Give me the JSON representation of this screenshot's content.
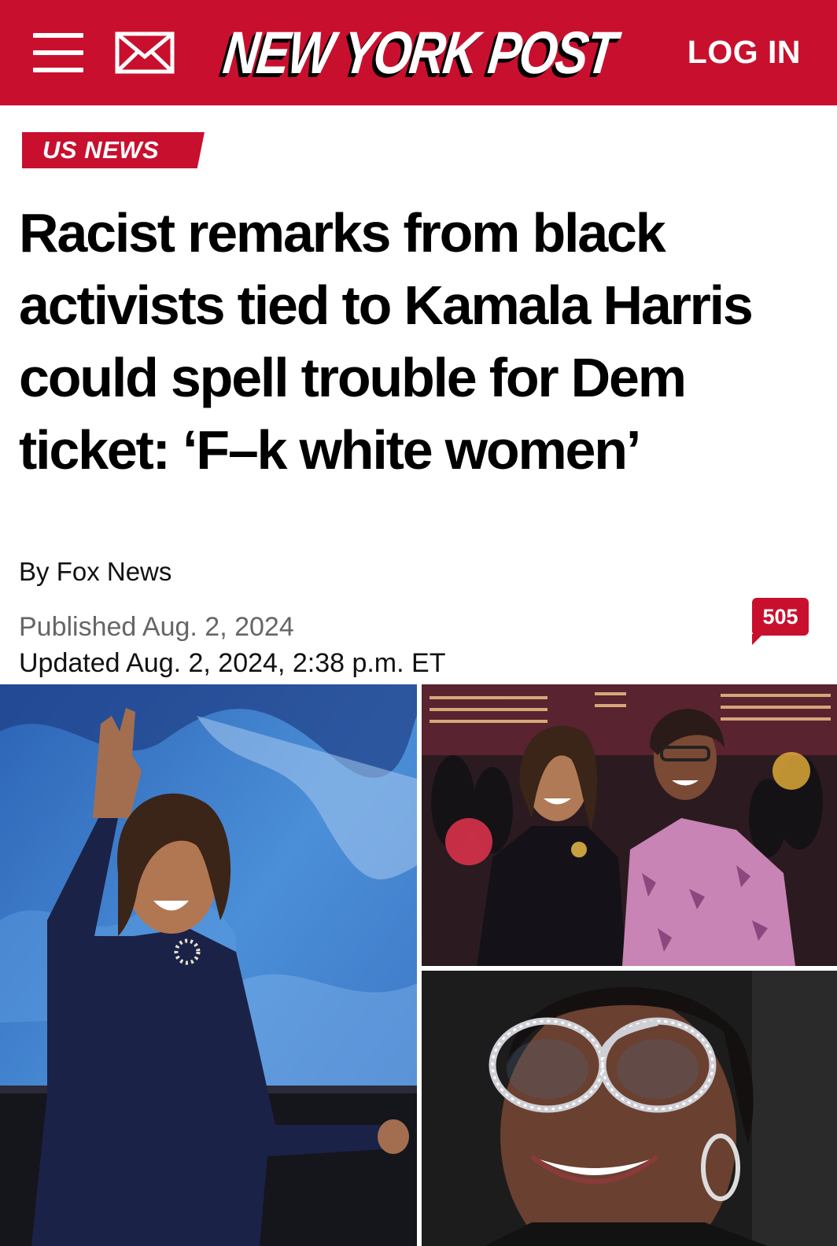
{
  "header": {
    "logo_text": "NEW YORK POST",
    "login_label": "LOG IN",
    "menu_icon": "hamburger-menu-icon",
    "mail_icon": "envelope-icon",
    "brand_color": "#c8102e"
  },
  "article": {
    "category": "US NEWS",
    "headline": "Racist remarks from black activists tied to Kamala Harris could spell trouble for Dem ticket: ‘F–k white women’",
    "byline_prefix": "By ",
    "author": "Fox News",
    "published": "Published Aug. 2, 2024",
    "updated": "Updated Aug. 2, 2024, 2:38 p.m. ET",
    "comment_count": "505"
  }
}
